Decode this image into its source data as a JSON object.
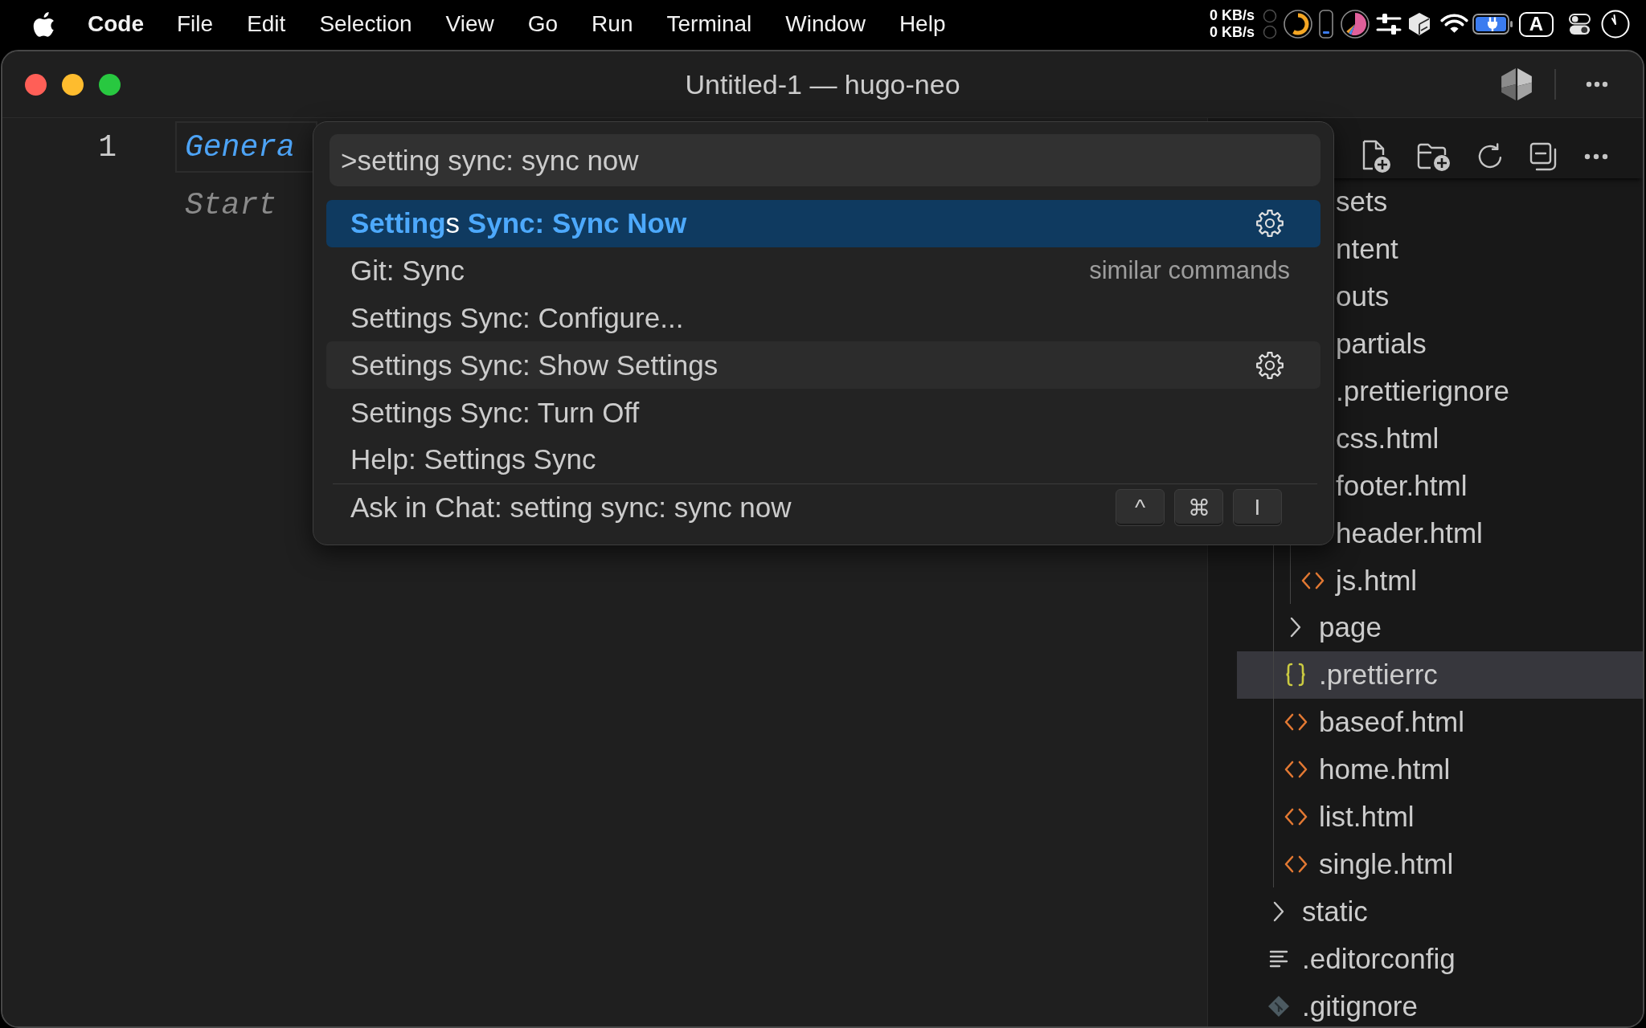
{
  "menu_bar": {
    "app": "Code",
    "menus": [
      "File",
      "Edit",
      "Selection",
      "View",
      "Go",
      "Run",
      "Terminal",
      "Window",
      "Help"
    ],
    "network": [
      "0 KB/s",
      "0 KB/s"
    ],
    "input_source": "A"
  },
  "window": {
    "title": "Untitled-1 — hugo-neo"
  },
  "editor": {
    "line_number": "1",
    "hint_lines": [
      {
        "text": "Genera",
        "kind": "link"
      },
      {
        "text": "Start",
        "kind": "muted"
      }
    ]
  },
  "command_palette": {
    "query": ">setting sync: sync now",
    "items": [
      {
        "label": "**Setting**s **Sync: Sync Now**",
        "selected": true,
        "hovered": false
      },
      {
        "label": "Git: Sync",
        "group": "similar commands",
        "selected": false,
        "hovered": false
      },
      {
        "label": "Settings Sync: Configure...",
        "selected": false,
        "hovered": false
      },
      {
        "label": "Settings Sync: Show Settings",
        "selected": false,
        "hovered": true
      },
      {
        "label": "Settings Sync: Turn Off",
        "selected": false,
        "hovered": false
      },
      {
        "label": "Help: Settings Sync",
        "selected": false,
        "hovered": false
      }
    ],
    "chat": {
      "label": "Ask in Chat: setting sync: sync now",
      "keys": [
        "^",
        "⌘",
        "I"
      ],
      "selected": false,
      "hovered": false
    }
  },
  "explorer": {
    "tree": [
      {
        "children": [
          {
            "children": [
              {
                "label": "sets",
                "selected": false
              },
              {
                "label": "ntent",
                "selected": false
              },
              {
                "label": "outs",
                "selected": false
              },
              {
                "label": "partials",
                "selected": false
              },
              {
                "label": ".prettierignore",
                "selected": false
              },
              {
                "label": "css.html",
                "selected": false
              },
              {
                "label": "footer.html",
                "selected": false
              },
              {
                "label": "header.html",
                "selected": false
              },
              {
                "label": "js.html",
                "kind": "html",
                "selected": false
              }
            ]
          },
          {
            "label": "page",
            "kind": "folder",
            "expanded": false,
            "selected": false
          },
          {
            "label": ".prettierrc",
            "kind": "json",
            "selected": true
          },
          {
            "label": "baseof.html",
            "kind": "html",
            "selected": false
          },
          {
            "label": "home.html",
            "kind": "html",
            "selected": false
          },
          {
            "label": "list.html",
            "kind": "html",
            "selected": false
          },
          {
            "label": "single.html",
            "kind": "html",
            "selected": false
          }
        ]
      },
      {
        "label": "static",
        "kind": "folder",
        "expanded": false,
        "selected": false
      },
      {
        "label": ".editorconfig",
        "kind": "config",
        "selected": false
      },
      {
        "label": ".gitignore",
        "kind": "git",
        "selected": false
      }
    ]
  }
}
